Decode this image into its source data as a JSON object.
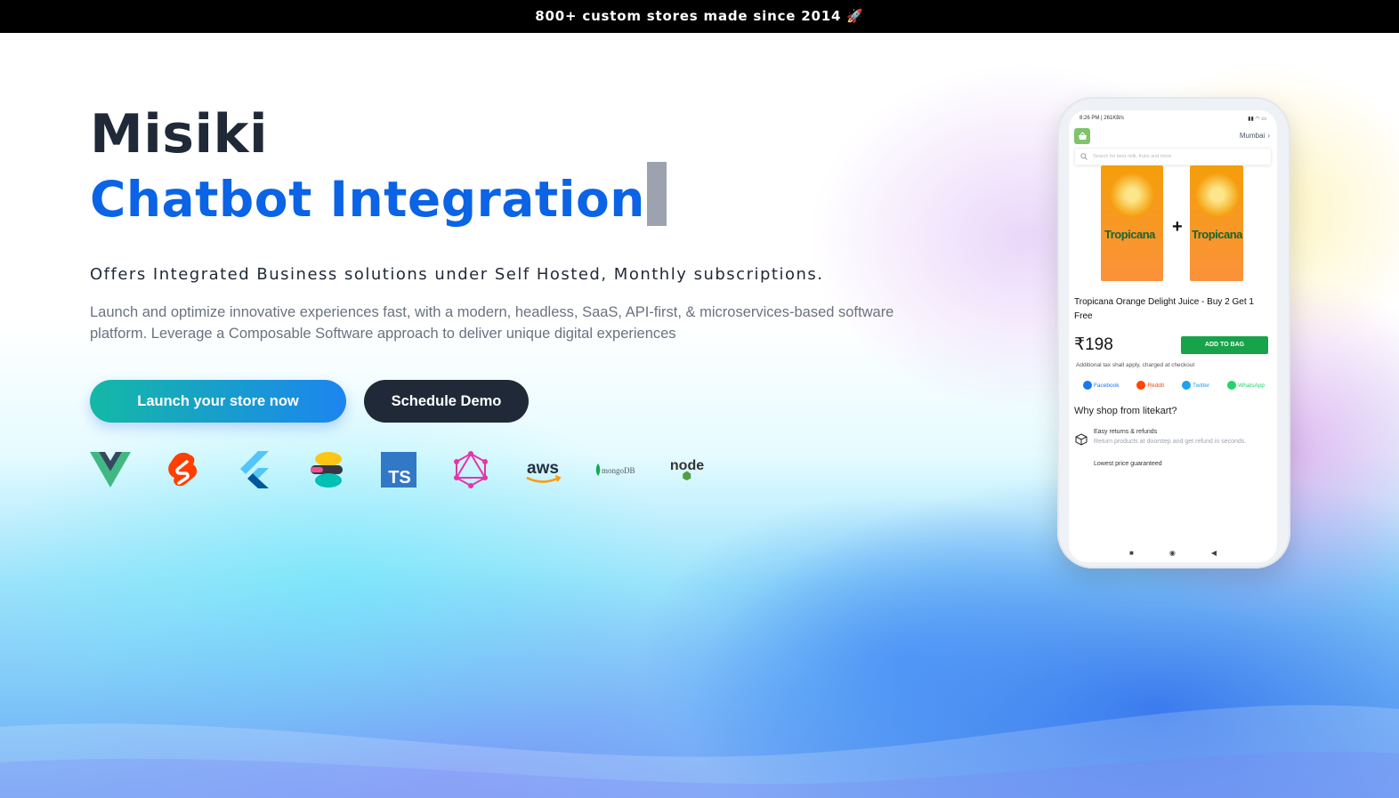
{
  "announcement": {
    "text": "800+ custom stores made since 2014 🚀"
  },
  "hero": {
    "brand": "Misiki",
    "product": "Chatbot Integration",
    "subtitle": "Offers Integrated Business solutions under Self Hosted, Monthly subscriptions.",
    "description": "Launch and optimize innovative experiences fast, with a modern, headless, SaaS, API-first, & microservices-based software platform. Leverage a Composable Software approach to deliver unique digital experiences",
    "primary_cta": "Launch your store now",
    "secondary_cta": "Schedule Demo"
  },
  "tech_logos": [
    {
      "name": "vue-icon"
    },
    {
      "name": "svelte-icon"
    },
    {
      "name": "flutter-icon"
    },
    {
      "name": "elastic-icon"
    },
    {
      "name": "typescript-icon",
      "text": "TS"
    },
    {
      "name": "graphql-icon"
    },
    {
      "name": "aws-icon",
      "text": "aws"
    },
    {
      "name": "mongodb-icon",
      "text": "mongoDB"
    },
    {
      "name": "nodejs-icon",
      "text": "node"
    }
  ],
  "phone": {
    "status_left": "8:26 PM | 261KB/s",
    "city": "Mumbai",
    "search_placeholder": "Search for best milk, fruits and more",
    "carton_brand": "Tropicana",
    "product_name": "Tropicana Orange Delight Juice - Buy 2 Get 1 Free",
    "price": "₹198",
    "add_button": "ADD TO BAG",
    "tax_note": "Additional tax shall apply, charged at checkout",
    "share": [
      "Facebook",
      "Reddit",
      "Twitter",
      "WhatsApp"
    ],
    "why_title": "Why shop from litekart?",
    "feature1_title": "Easy returns & refunds",
    "feature1_sub": "Return products at doorstep and get refund in seconds.",
    "feature2_title": "Lowest price guaranteed"
  },
  "colors": {
    "accent_blue": "#0b63e5",
    "dark": "#1f2937",
    "gradient_start": "#14b8a6",
    "gradient_end": "#1c85f0",
    "add_button": "#16a34a"
  }
}
